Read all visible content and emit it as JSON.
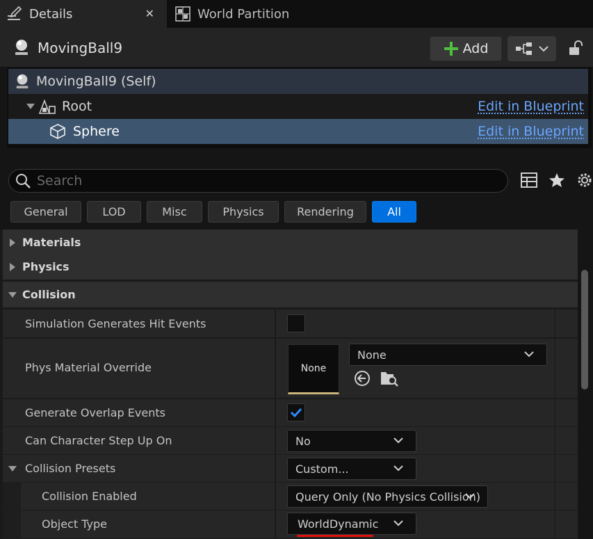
{
  "tabs": [
    {
      "label": "Details",
      "icon": "pencil-icon"
    },
    {
      "label": "World Partition",
      "icon": "grid-icon"
    }
  ],
  "actor": {
    "name": "MovingBall9",
    "add_label": "Add"
  },
  "components": {
    "self_label": "MovingBall9 (Self)",
    "root_label": "Root",
    "sphere_label": "Sphere",
    "edit_link": "Edit in Blueprint"
  },
  "search": {
    "placeholder": "Search"
  },
  "filters": [
    "General",
    "LOD",
    "Misc",
    "Physics",
    "Rendering",
    "All"
  ],
  "active_filter": "All",
  "categories": {
    "materials": "Materials",
    "physics": "Physics",
    "collision": "Collision"
  },
  "properties": {
    "sim_hit": {
      "label": "Simulation Generates Hit Events",
      "checked": false
    },
    "phys_mat": {
      "label": "Phys Material Override",
      "thumb": "None",
      "value": "None"
    },
    "overlap": {
      "label": "Generate Overlap Events",
      "checked": true
    },
    "step_up": {
      "label": "Can Character Step Up On",
      "value": "No"
    },
    "presets": {
      "label": "Collision Presets",
      "value": "Custom..."
    },
    "enabled": {
      "label": "Collision Enabled",
      "value": "Query Only (No Physics Collision)"
    },
    "object_type": {
      "label": "Object Type",
      "value": "WorldDynamic"
    }
  },
  "colors": {
    "accent": "#0070e0",
    "link": "#6aa6ff",
    "selection": "#3e5570",
    "checkmark": "#2f8cff",
    "add_plus": "#4fbf3f",
    "underline_error": "#e01010"
  }
}
